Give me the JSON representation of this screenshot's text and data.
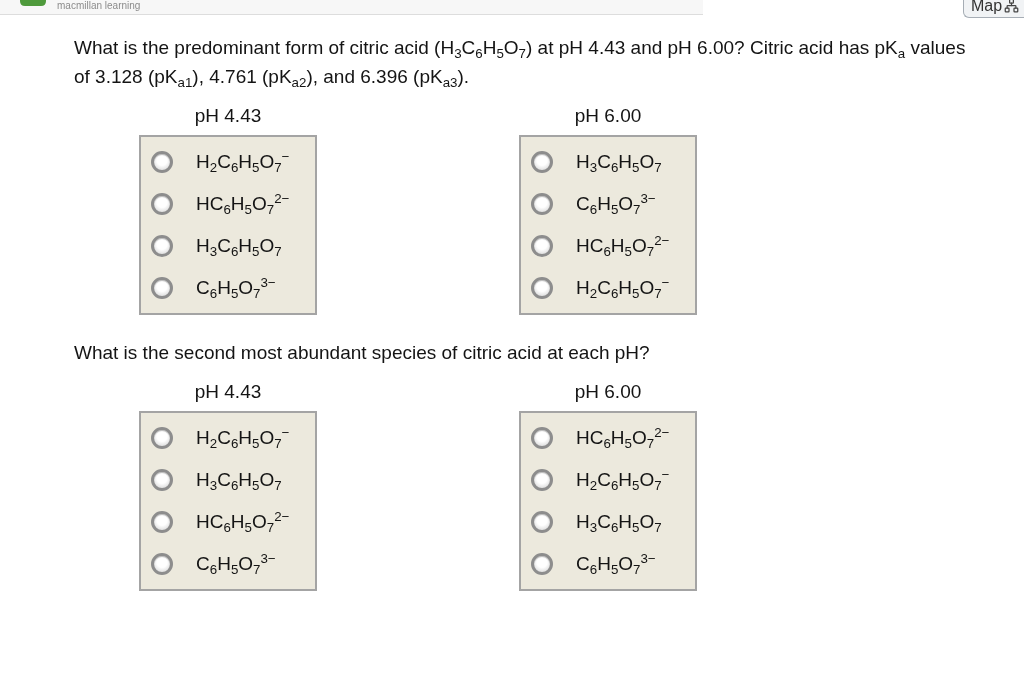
{
  "header": {
    "brand": "macmillan learning",
    "map_button": "Map"
  },
  "questions": [
    {
      "prompt": "What is the predominant form of citric acid (H$_{3}$C$_{6}$H$_{5}$O$_{7}$) at pH 4.43 and pH 6.00? Citric acid has pK$_{a}$ values of 3.128 (pK$_{a1}$), 4.761 (pK$_{a2}$), and 6.396 (pK$_{a3}$).",
      "groups": [
        {
          "label": "pH 4.43",
          "options": [
            {
              "formula": "H$_{2}$C$_{6}$H$_{5}$O$_{7}$$^{−}$",
              "selected": false
            },
            {
              "formula": "HC$_{6}$H$_{5}$O$_{7}$$^{2−}$",
              "selected": false
            },
            {
              "formula": "H$_{3}$C$_{6}$H$_{5}$O$_{7}$",
              "selected": false
            },
            {
              "formula": "C$_{6}$H$_{5}$O$_{7}$$^{3−}$",
              "selected": false
            }
          ]
        },
        {
          "label": "pH 6.00",
          "options": [
            {
              "formula": "H$_{3}$C$_{6}$H$_{5}$O$_{7}$",
              "selected": false
            },
            {
              "formula": "C$_{6}$H$_{5}$O$_{7}$$^{3−}$",
              "selected": false
            },
            {
              "formula": "HC$_{6}$H$_{5}$O$_{7}$$^{2−}$",
              "selected": false
            },
            {
              "formula": "H$_{2}$C$_{6}$H$_{5}$O$_{7}$$^{−}$",
              "selected": false
            }
          ]
        }
      ]
    },
    {
      "prompt": "What is the second most abundant species of citric acid at each pH?",
      "groups": [
        {
          "label": "pH 4.43",
          "options": [
            {
              "formula": "H$_{2}$C$_{6}$H$_{5}$O$_{7}$$^{−}$",
              "selected": false
            },
            {
              "formula": "H$_{3}$C$_{6}$H$_{5}$O$_{7}$",
              "selected": false
            },
            {
              "formula": "HC$_{6}$H$_{5}$O$_{7}$$^{2−}$",
              "selected": false
            },
            {
              "formula": "C$_{6}$H$_{5}$O$_{7}$$^{3−}$",
              "selected": false
            }
          ]
        },
        {
          "label": "pH 6.00",
          "options": [
            {
              "formula": "HC$_{6}$H$_{5}$O$_{7}$$^{2−}$",
              "selected": false
            },
            {
              "formula": "H$_{2}$C$_{6}$H$_{5}$O$_{7}$$^{−}$",
              "selected": false
            },
            {
              "formula": "H$_{3}$C$_{6}$H$_{5}$O$_{7}$",
              "selected": false
            },
            {
              "formula": "C$_{6}$H$_{5}$O$_{7}$$^{3−}$",
              "selected": false
            }
          ]
        }
      ]
    }
  ]
}
